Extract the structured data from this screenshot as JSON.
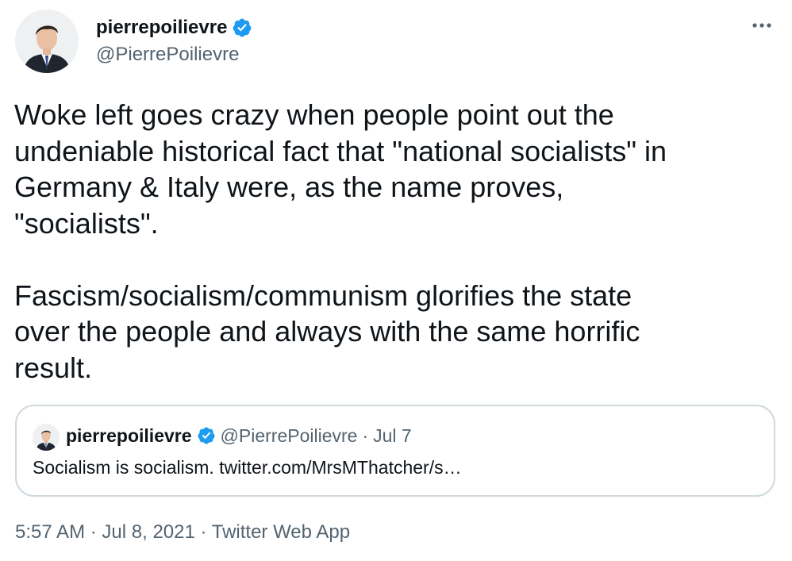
{
  "author": {
    "display_name": "pierrepoilievre",
    "handle": "@PierrePoilievre",
    "verified": true,
    "avatar_icon": "profile-photo"
  },
  "tweet": {
    "text": "Woke left goes crazy when people point out the\nundeniable historical fact that \"national socialists\" in\nGermany & Italy were, as the name proves,\n\"socialists\".\n\nFascism/socialism/communism glorifies the state\nover the people and always with the same horrific\nresult.",
    "time": "5:57 AM",
    "date": "Jul 8, 2021",
    "source": "Twitter Web App",
    "separator": "·"
  },
  "quoted_tweet": {
    "display_name": "pierrepoilievre",
    "handle": "@PierrePoilievre",
    "separator": "·",
    "date": "Jul 7",
    "text": "Socialism is socialism. twitter.com/MrsMThatcher/s…"
  },
  "colors": {
    "verified_blue": "#1d9bf0",
    "text_primary": "#0f1419",
    "text_secondary": "#536471",
    "border": "#cfd9de"
  },
  "icons": {
    "more": "more-horizontal-icon",
    "verified": "verified-badge-icon"
  }
}
